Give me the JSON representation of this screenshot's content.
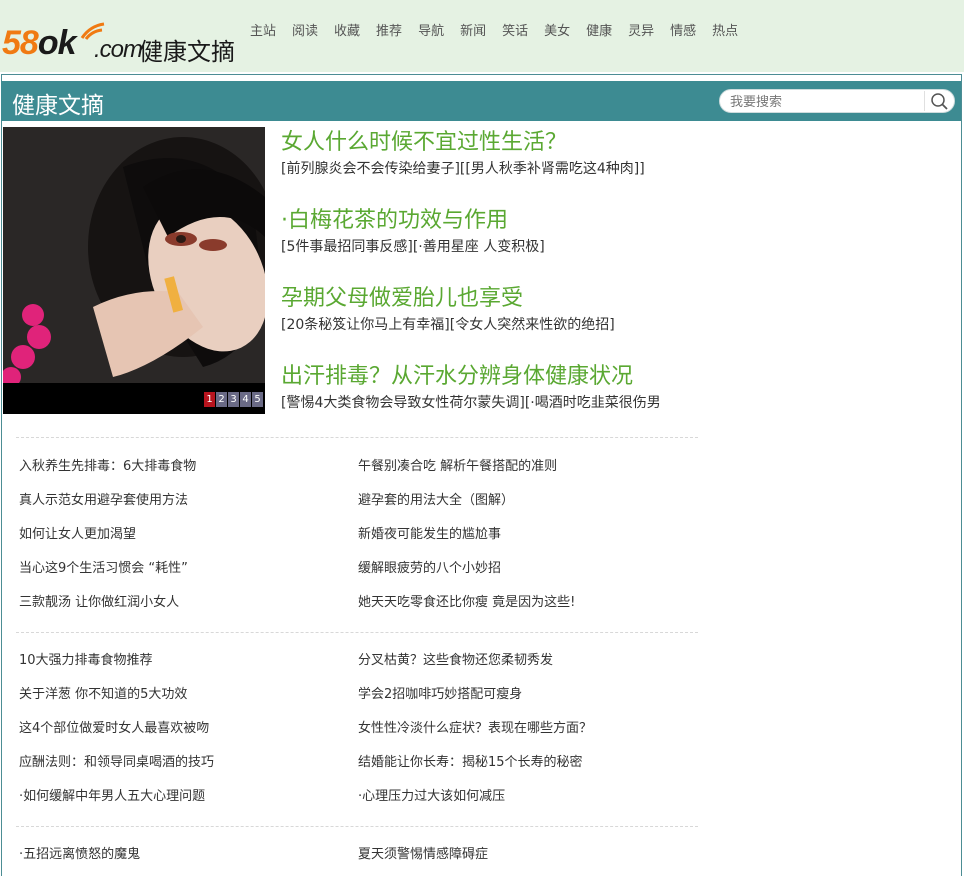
{
  "logo": {
    "brand_prefix": "58",
    "brand_k": "ok",
    "dotcom": ".com",
    "site_name": "健康文摘"
  },
  "nav": [
    "主站",
    "阅读",
    "收藏",
    "推荐",
    "导航",
    "新闻",
    "笑话",
    "美女",
    "健康",
    "灵异",
    "情感",
    "热点"
  ],
  "section_title": "健康文摘",
  "search": {
    "placeholder": "我要搜索"
  },
  "slideshow": {
    "pages": [
      "1",
      "2",
      "3",
      "4",
      "5"
    ],
    "active_page": 1
  },
  "features": [
    {
      "title": "女人什么时候不宜过性生活？",
      "subtitle": "[前列腺炎会不会传染给妻子][[男人秋季补肾需吃这4种肉]]"
    },
    {
      "title": "·白梅花茶的功效与作用",
      "subtitle": "[5件事最招同事反感][·善用星座 人变积极]"
    },
    {
      "title": "孕期父母做爱胎儿也享受",
      "subtitle": "[20条秘笈让你马上有幸福][令女人突然来性欲的绝招]"
    },
    {
      "title": "出汗排毒？从汗水分辨身体健康状况",
      "subtitle": "[警惕4大类食物会导致女性荷尔蒙失调][·喝酒时吃韭菜很伤男"
    }
  ],
  "groups": [
    {
      "left": [
        "入秋养生先排毒：6大排毒食物",
        "真人示范女用避孕套使用方法",
        "如何让女人更加渴望",
        "当心这9个生活习惯会 “耗性”",
        "三款靓汤 让你做红润小女人"
      ],
      "right": [
        "午餐别凑合吃 解析午餐搭配的准则",
        "避孕套的用法大全（图解）",
        "新婚夜可能发生的尴尬事",
        "缓解眼疲劳的八个小妙招",
        "她天天吃零食还比你瘦 竟是因为这些!"
      ]
    },
    {
      "left": [
        "10大强力排毒食物推荐",
        "关于洋葱 你不知道的5大功效",
        "这4个部位做爱时女人最喜欢被吻",
        "应酬法则：和领导同桌喝酒的技巧",
        "·如何缓解中年男人五大心理问题"
      ],
      "right": [
        "分叉枯黄？这些食物还您柔韧秀发",
        "学会2招咖啡巧妙搭配可瘦身",
        "女性性冷淡什么症状？表现在哪些方面？",
        "结婚能让你长寿：揭秘15个长寿的秘密",
        "·心理压力过大该如何减压"
      ]
    },
    {
      "left": [
        "·五招远离愤怒的魔鬼"
      ],
      "right": [
        "夏天须警惕情感障碍症"
      ]
    }
  ]
}
